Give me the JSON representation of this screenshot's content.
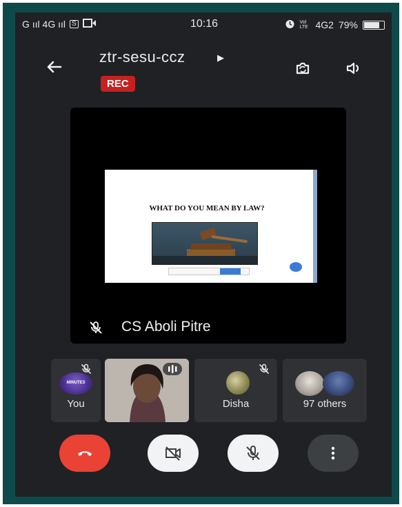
{
  "status_bar": {
    "left_indicators": "G ııl 4G ııl",
    "sim_badge": "S",
    "time": "10:16",
    "lte_badge": "Vol LTE",
    "network": "4G2",
    "battery_percent": "79%",
    "battery_level": 0.79
  },
  "header": {
    "meeting_code": "ztr-sesu-ccz",
    "rec_label": "REC"
  },
  "presentation": {
    "slide_heading": "WHAT DO YOU MEAN BY LAW?",
    "speaker_name": "CS Aboli Pitre"
  },
  "participants": [
    {
      "label": "You",
      "avatar_text": "MINUTES"
    },
    {
      "label": ""
    },
    {
      "label": "Disha"
    },
    {
      "label": "97 others"
    }
  ],
  "colors": {
    "background": "#202124",
    "tile": "#303134",
    "rec": "#c5221f",
    "end_call": "#ea4335",
    "frame": "#0f4a4a"
  },
  "controls": {
    "end_call": "phone-hangup-icon",
    "camera": "video-off-icon",
    "mic": "mic-off-icon",
    "more": "more-vert-icon"
  }
}
